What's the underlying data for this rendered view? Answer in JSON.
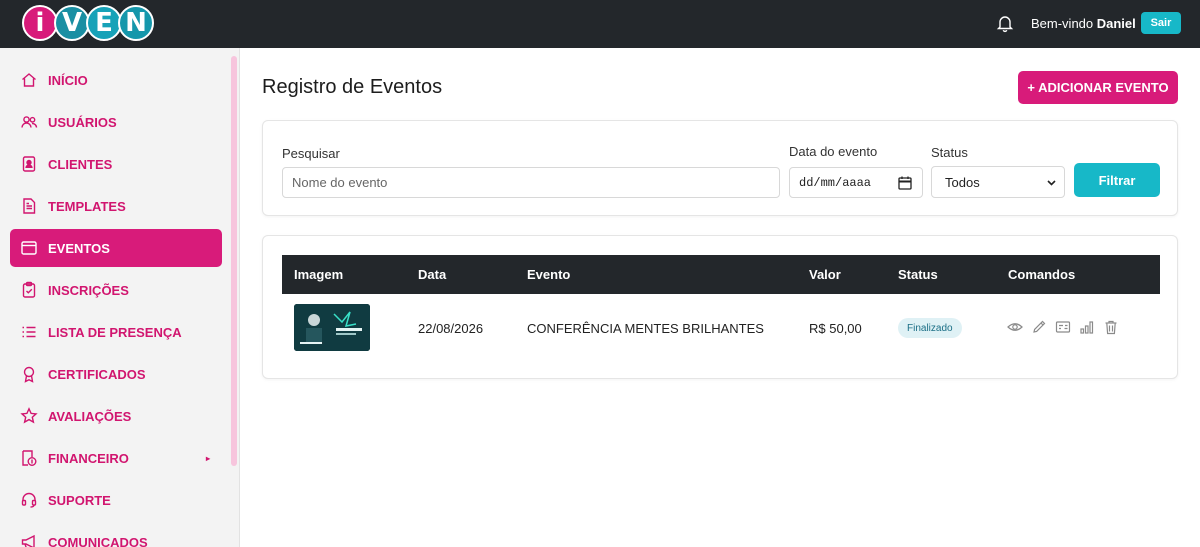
{
  "header": {
    "logo_letters": [
      "i",
      "V",
      "E",
      "N"
    ],
    "welcome_prefix": "Bem-vindo ",
    "user_name": "Daniel",
    "logout_label": "Sair",
    "bell_icon": "bell-icon"
  },
  "sidebar": {
    "items": [
      {
        "label": "INÍCIO",
        "icon": "home-icon"
      },
      {
        "label": "USUÁRIOS",
        "icon": "users-icon"
      },
      {
        "label": "CLIENTES",
        "icon": "id-badge-icon"
      },
      {
        "label": "TEMPLATES",
        "icon": "document-icon"
      },
      {
        "label": "EVENTOS",
        "icon": "window-icon",
        "active": true
      },
      {
        "label": "INSCRIÇÕES",
        "icon": "clipboard-icon"
      },
      {
        "label": "LISTA DE PRESENÇA",
        "icon": "list-icon"
      },
      {
        "label": "CERTIFICADOS",
        "icon": "award-icon"
      },
      {
        "label": "AVALIAÇÕES",
        "icon": "star-icon"
      },
      {
        "label": "FINANCEIRO",
        "icon": "receipt-icon",
        "has_submenu": true
      },
      {
        "label": "SUPORTE",
        "icon": "headset-icon"
      },
      {
        "label": "COMUNICADOS",
        "icon": "megaphone-icon"
      }
    ]
  },
  "main": {
    "title": "Registro de Eventos",
    "add_button_label": "+ ADICIONAR EVENTO",
    "filters": {
      "search_label": "Pesquisar",
      "search_placeholder": "Nome do evento",
      "date_label": "Data do evento",
      "date_placeholder": "dd/mm/aaaa",
      "status_label": "Status",
      "status_value": "Todos",
      "filter_button_label": "Filtrar"
    },
    "table": {
      "columns": [
        "Imagem",
        "Data",
        "Evento",
        "Valor",
        "Status",
        "Comandos"
      ],
      "rows": [
        {
          "date": "22/08/2026",
          "event": "CONFERÊNCIA MENTES BRILHANTES",
          "value": "R$ 50,00",
          "status": "Finalizado",
          "commands": [
            "eye-icon",
            "pencil-icon",
            "id-card-icon",
            "bar-chart-icon",
            "trash-icon"
          ]
        }
      ]
    }
  },
  "colors": {
    "brand_pink": "#d81b7a",
    "accent_teal": "#17b8c8",
    "header_dark": "#23272b",
    "badge_bg": "#dff1f5"
  }
}
